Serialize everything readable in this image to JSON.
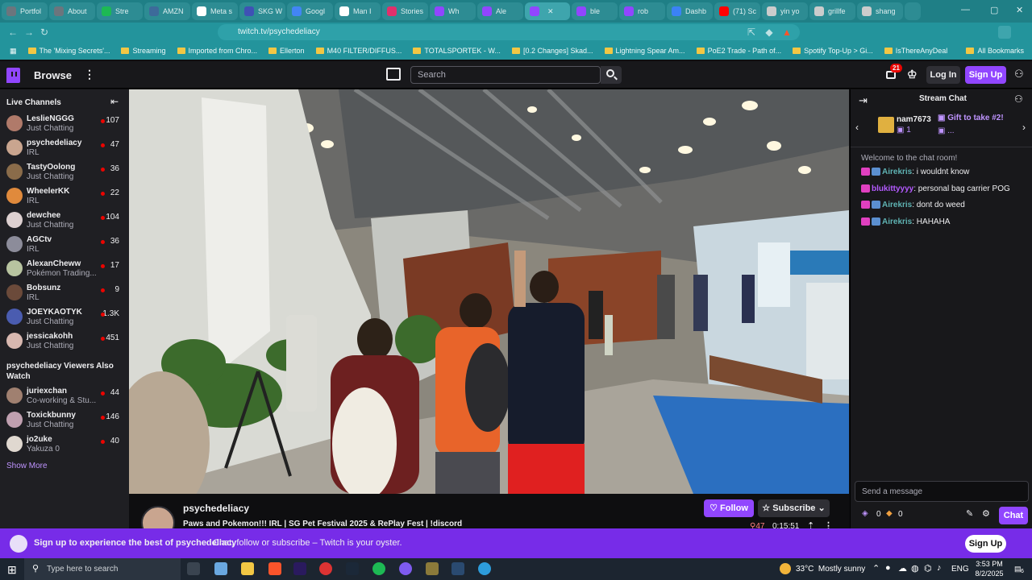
{
  "browser": {
    "tabs": [
      {
        "label": "Portfol",
        "color": "#6c757d"
      },
      {
        "label": "About",
        "color": "#6c757d"
      },
      {
        "label": "Stre",
        "color": "#1db954"
      },
      {
        "label": "AMZN",
        "color": "#3d6b9a"
      },
      {
        "label": "Meta s",
        "color": "#ffffff"
      },
      {
        "label": "SKG W",
        "color": "#3f51b5"
      },
      {
        "label": "Googl",
        "color": "#4285f4"
      },
      {
        "label": "Man I",
        "color": "#ffffff"
      },
      {
        "label": "Stories",
        "color": "#e1306c"
      },
      {
        "label": "Wh",
        "color": "#9146ff"
      },
      {
        "label": "Ale",
        "color": "#9146ff"
      },
      {
        "label": "",
        "color": "#9146ff",
        "active": true
      },
      {
        "label": "ble",
        "color": "#9146ff"
      },
      {
        "label": "rob",
        "color": "#9146ff"
      },
      {
        "label": "Dashb",
        "color": "#3b82f6"
      },
      {
        "label": "(71) Sc",
        "color": "#ff0000"
      },
      {
        "label": "yin yo",
        "color": "#cccccc"
      },
      {
        "label": "grillfe",
        "color": "#cccccc"
      },
      {
        "label": "shang",
        "color": "#cccccc"
      }
    ],
    "url": "twitch.tv/psychedeliacy",
    "bookmarks": [
      {
        "label": "The 'Mixing Secrets'..."
      },
      {
        "label": "Streaming"
      },
      {
        "label": "Imported from Chro..."
      },
      {
        "label": "Ellerton"
      },
      {
        "label": "M40 FILTER/DIFFUS..."
      },
      {
        "label": "TOTALSPORTEK - W..."
      },
      {
        "label": "[0.2 Changes] Skad..."
      },
      {
        "label": "Lightning Spear Am..."
      },
      {
        "label": "PoE2 Trade - Path of..."
      },
      {
        "label": "Spotify Top-Up > Gi..."
      },
      {
        "label": "IsThereAnyDeal"
      }
    ],
    "all_bookmarks": "All Bookmarks"
  },
  "twitch_nav": {
    "browse": "Browse",
    "search_placeholder": "Search",
    "notif_count": "21",
    "login": "Log In",
    "signup": "Sign Up"
  },
  "sidebar": {
    "live_title": "Live Channels",
    "channels": [
      {
        "name": "LeslieNGGG",
        "game": "Just Chatting",
        "viewers": "107",
        "color": "#b07a6a"
      },
      {
        "name": "psychedeliacy",
        "game": "IRL",
        "viewers": "47",
        "color": "#c9a58f"
      },
      {
        "name": "TastyOolong",
        "game": "Just Chatting",
        "viewers": "36",
        "color": "#8a6c4a"
      },
      {
        "name": "WheelerKK",
        "game": "IRL",
        "viewers": "22",
        "color": "#e08a3c"
      },
      {
        "name": "dewchee",
        "game": "Just Chatting",
        "viewers": "104",
        "color": "#ddd0d0"
      },
      {
        "name": "AGCtv",
        "game": "IRL",
        "viewers": "36",
        "color": "#8c8c9a"
      },
      {
        "name": "AlexanCheww",
        "game": "Pokémon Trading...",
        "viewers": "17",
        "color": "#b8c4a0"
      },
      {
        "name": "Bobsunz",
        "game": "IRL",
        "viewers": "9",
        "color": "#6b4a3a"
      },
      {
        "name": "JOEYKAOTYK",
        "game": "Just Chatting",
        "viewers": "1.3K",
        "color": "#4a5cb0"
      },
      {
        "name": "jessicakohh",
        "game": "Just Chatting",
        "viewers": "451",
        "color": "#d8b8b0"
      }
    ],
    "also_watch_title": "psychedeliacy Viewers Also Watch",
    "also_watch": [
      {
        "name": "juriexchan",
        "game": "Co-working & Stu...",
        "viewers": "44",
        "color": "#a08070"
      },
      {
        "name": "Toxickbunny",
        "game": "Just Chatting",
        "viewers": "146",
        "color": "#c0a0b0"
      },
      {
        "name": "jo2uke",
        "game": "Yakuza 0",
        "viewers": "40",
        "color": "#e0d8d0"
      }
    ],
    "show_more": "Show More"
  },
  "stream": {
    "streamer": "psychedeliacy",
    "title": "Paws and Pokemon!!! IRL | SG Pet Festival 2025 & RePlay Fest | !discord",
    "follow": "Follow",
    "subscribe": "Subscribe",
    "viewers": "47",
    "uptime": "0:15:51"
  },
  "chat": {
    "title": "Stream Chat",
    "gift_user": "nam7673",
    "gift_count": "1",
    "gift_text": "Gift to take #2!",
    "gift_more": "...",
    "welcome": "Welcome to the chat room!",
    "messages": [
      {
        "user": "Airekris",
        "color": "#5fb3b3",
        "text": ": i wouldnt know"
      },
      {
        "user": "blukittyyyy",
        "color": "#b45aff",
        "text": ": personal bag carrier POG"
      },
      {
        "user": "Airekris",
        "color": "#5fb3b3",
        "text": ": dont do weed"
      },
      {
        "user": "Airekris",
        "color": "#5fb3b3",
        "text": ": HAHAHA"
      }
    ],
    "input_placeholder": "Send a message",
    "points_a": "0",
    "points_b": "0",
    "chat_button": "Chat"
  },
  "banner": {
    "headline": "Sign up to experience the best of psychedeliacy",
    "sub": "Chat, follow or subscribe – Twitch is your oyster.",
    "button": "Sign Up"
  },
  "taskbar": {
    "search_placeholder": "Type here to search",
    "weather": "33°C  Mostly sunny",
    "lang": "ENG",
    "time": "3:53 PM",
    "date": "8/2/2025",
    "notif": "6"
  }
}
